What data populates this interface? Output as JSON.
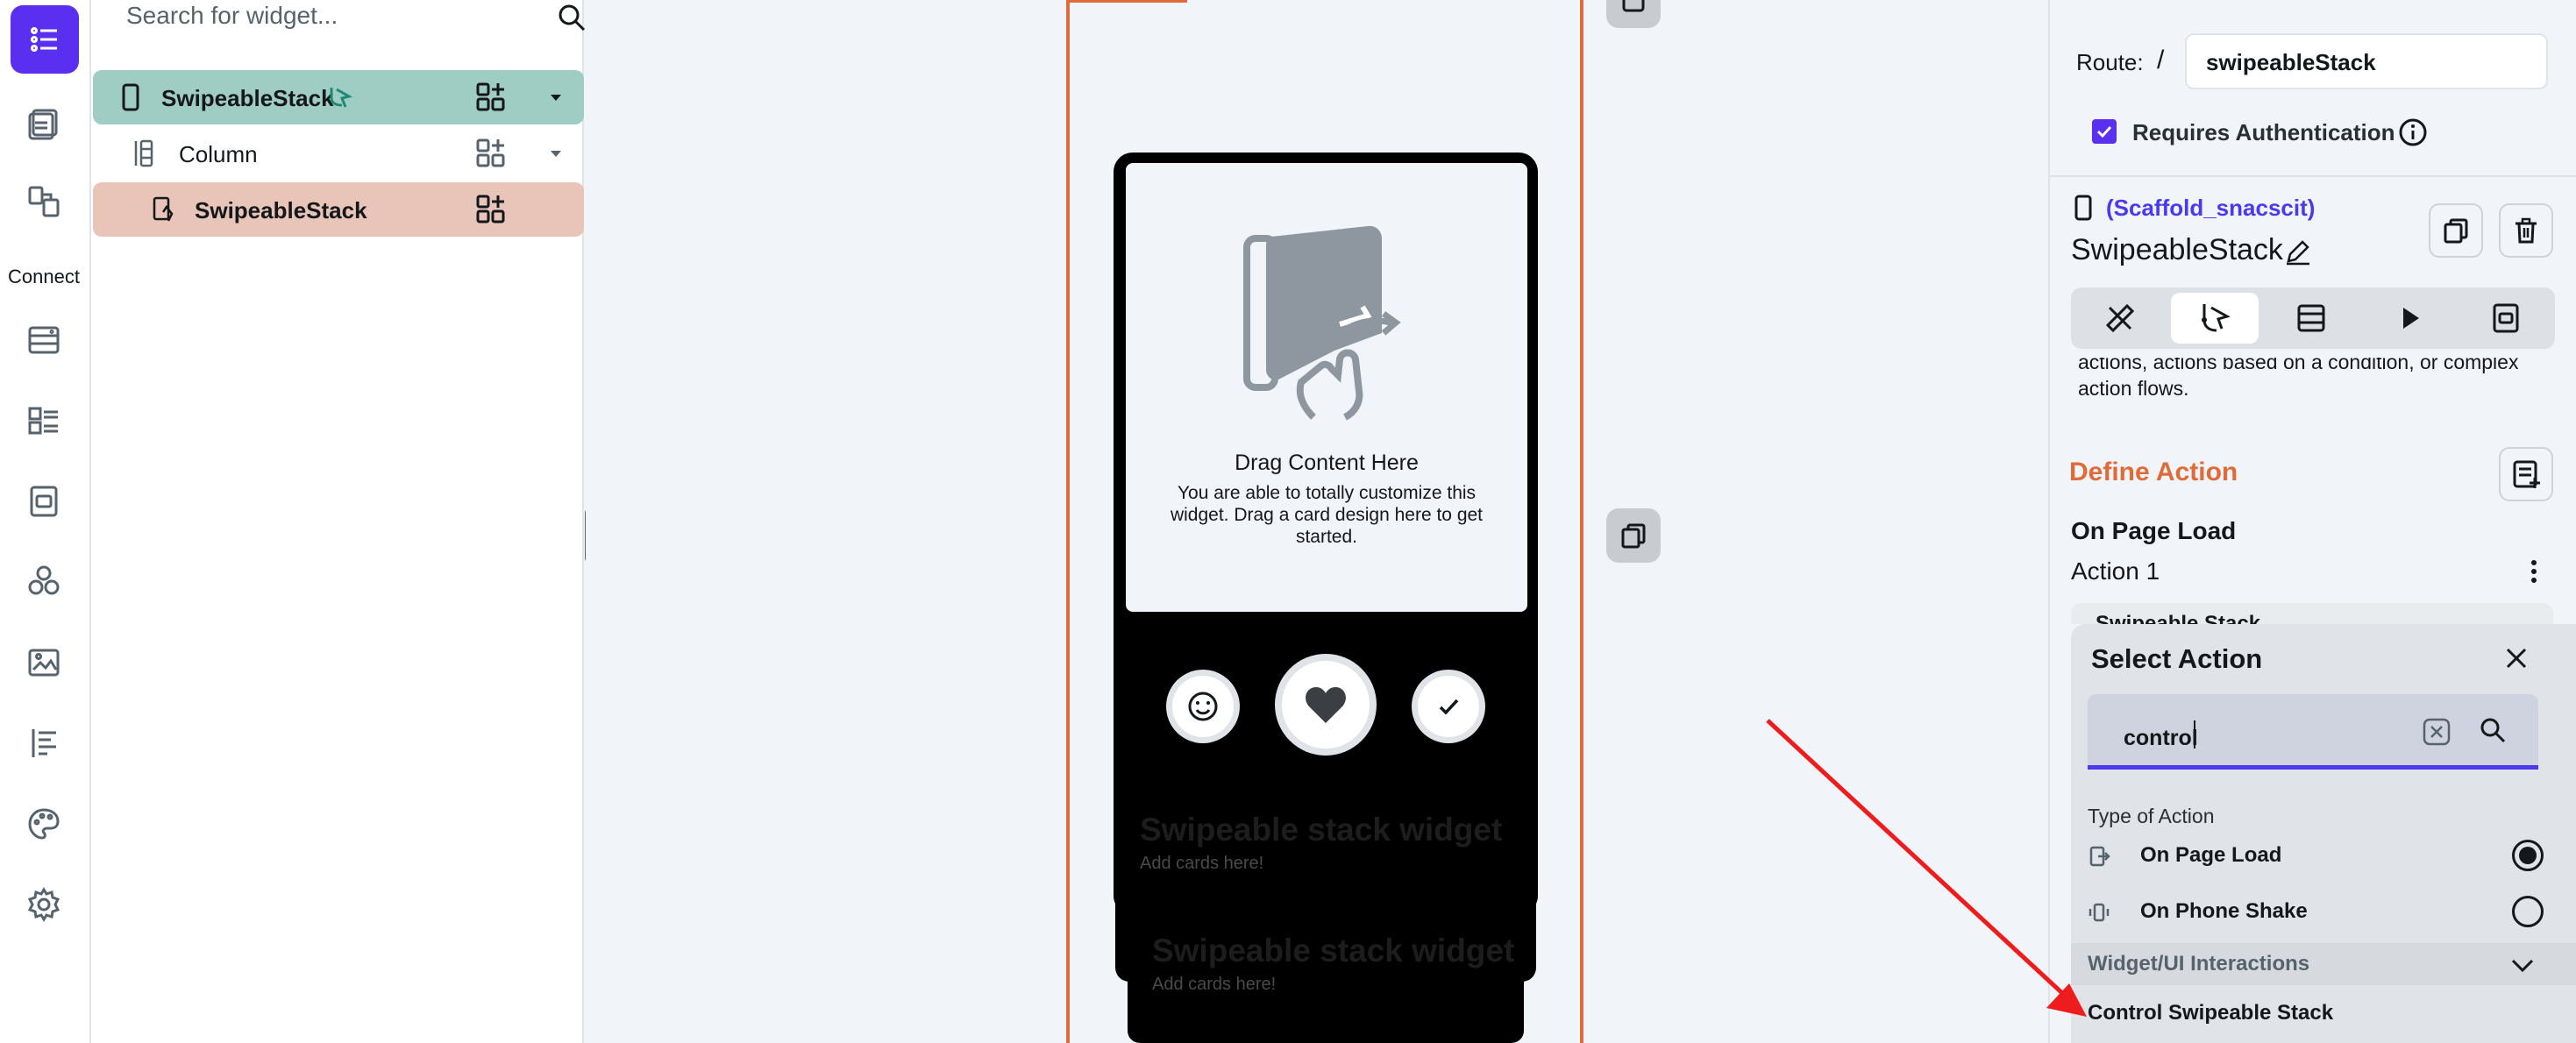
{
  "rail": {
    "connect_label": "Connect",
    "icons": [
      "widget-tree-icon",
      "pages-icon",
      "components-icon",
      "database-icon",
      "api-icon",
      "storage-icon",
      "integrations-icon",
      "media-icon",
      "theme-icon",
      "custom-code-icon",
      "settings-icon"
    ]
  },
  "tree": {
    "search_placeholder": "Search for widget...",
    "items": [
      {
        "label": "SwipeableStack",
        "type": "page"
      },
      {
        "label": "Column",
        "type": "column"
      },
      {
        "label": "SwipeableStack",
        "type": "swipeable-stack"
      }
    ]
  },
  "canvas": {
    "drag_title": "Drag Content Here",
    "drag_desc": "You are able to totally customize this widget. Drag a card design here to get started.",
    "ghost_cards": [
      {
        "title": "Swipeable stack widget",
        "sub": "Add cards here!"
      },
      {
        "title": "Swipeable stack widget",
        "sub": "Add cards here!"
      }
    ]
  },
  "props": {
    "route_label": "Route:",
    "route_slash": "/",
    "route_value": "swipeableStack",
    "requires_auth_label": "Requires Authentication",
    "requires_auth_checked": true,
    "scaffold_label": "(Scaffold_snacscit)",
    "widget_name": "SwipeableStack",
    "clipped_desc": "actions, actions based on a condition, or complex action flows.",
    "define_action_label": "Define Action",
    "trigger_label": "On Page Load",
    "action_label": "Action 1",
    "hidden_action_peek": "Swipeable Stack",
    "accent_color": "#4b39ef",
    "define_color": "#e06b3a"
  },
  "select_action": {
    "title": "Select Action",
    "search_value": "control",
    "type_of_action_label": "Type of Action",
    "options": [
      {
        "label": "On Page Load",
        "selected": true
      },
      {
        "label": "On Phone Shake",
        "selected": false
      }
    ],
    "group_label": "Widget/UI Interactions",
    "result_item": "Control Swipeable Stack"
  }
}
